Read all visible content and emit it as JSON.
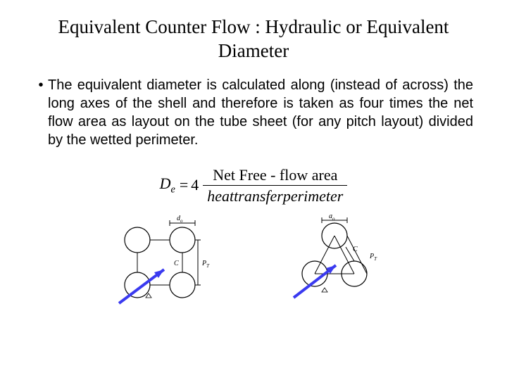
{
  "title": "Equivalent Counter Flow : Hydraulic or Equivalent Diameter",
  "bullet_text": "The equivalent diameter is calculated along (instead of across) the long axes of the shell and therefore is taken as four times the net flow area as layout on the tube sheet (for any pitch layout) divided by the wetted perimeter.",
  "formula": {
    "lhs_var": "D",
    "lhs_sub": "e",
    "equals": "=",
    "coef": "4",
    "numerator": "Net Free - flow area",
    "denominator": "heattransferperimeter"
  },
  "diagram_labels": {
    "d_o": "d",
    "d_o_sub": "o",
    "P_T": "P",
    "P_T_sub": "T",
    "C": "C"
  }
}
